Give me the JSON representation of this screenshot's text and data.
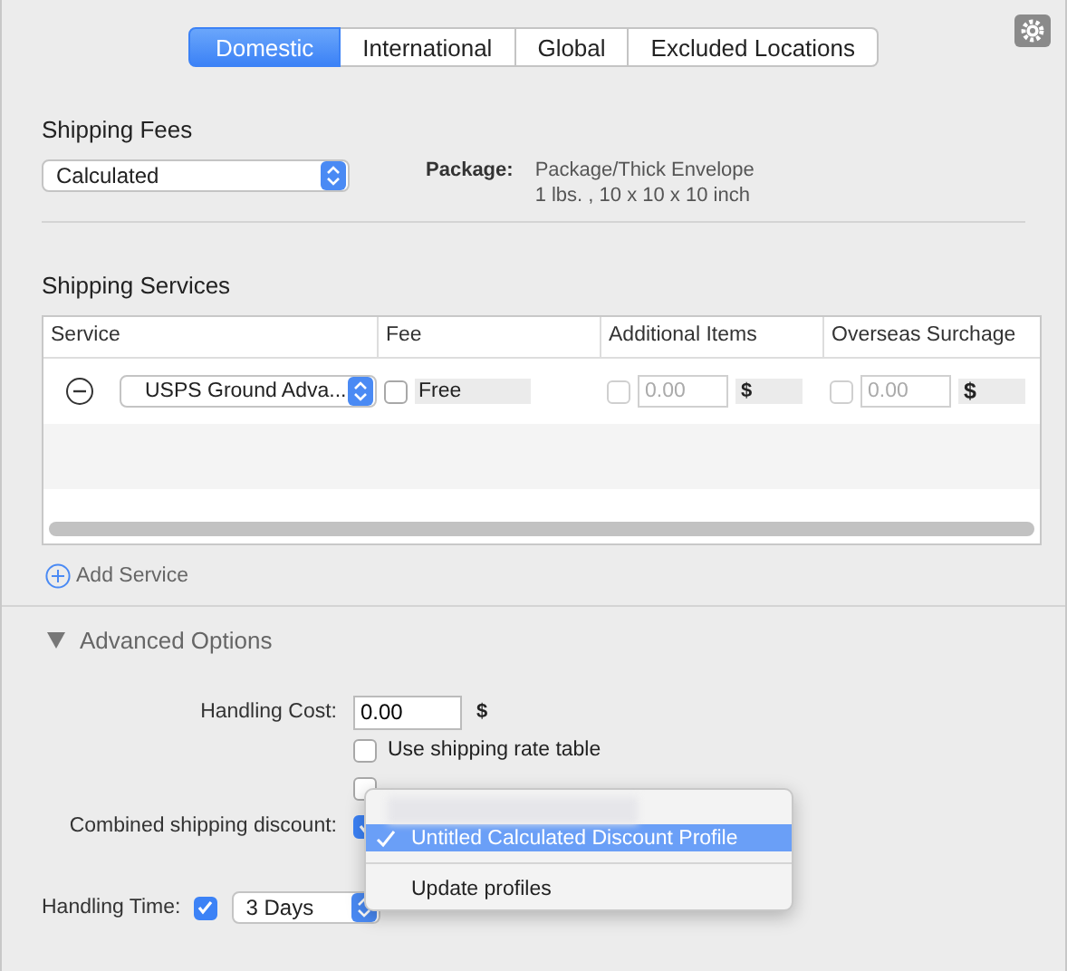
{
  "tabs": [
    {
      "label": "Domestic",
      "selected": true
    },
    {
      "label": "International",
      "selected": false
    },
    {
      "label": "Global",
      "selected": false
    },
    {
      "label": "Excluded Locations",
      "selected": false
    }
  ],
  "shipping_fees": {
    "heading": "Shipping Fees",
    "method": "Calculated",
    "package_label": "Package:",
    "package_lines": [
      "Package/Thick Envelope",
      "1 lbs. , 10 x 10 x 10 inch"
    ]
  },
  "shipping_services": {
    "heading": "Shipping Services",
    "columns": [
      "Service",
      "Fee",
      "Additional Items",
      "Overseas Surchage"
    ],
    "rows": [
      {
        "service": "USPS Ground Adva...",
        "fee_checked": false,
        "fee": "Free",
        "additional_checked": false,
        "additional_placeholder": "0.00",
        "additional_currency": "$",
        "surcharge_checked": false,
        "surcharge_placeholder": "0.00",
        "surcharge_currency": "$"
      }
    ],
    "add_button": "Add Service"
  },
  "advanced_options": {
    "title": "Advanced Options",
    "expanded": true,
    "handling_cost_label": "Handling Cost:",
    "handling_cost": "0.00",
    "currency": "$",
    "rate_table": {
      "label": "Use shipping rate table",
      "checked": false
    },
    "second_option": {
      "checked": false
    },
    "combined_label": "Combined shipping discount:",
    "combined_checked": true,
    "handling_time_label": "Handling Time:",
    "handling_time_checked": true,
    "handling_time": "3 Days"
  },
  "menu": {
    "items": [
      {
        "label": "Untitled Calculated Discount Profile",
        "selected": true
      },
      {
        "label": "Update profiles",
        "selected": false
      }
    ]
  }
}
